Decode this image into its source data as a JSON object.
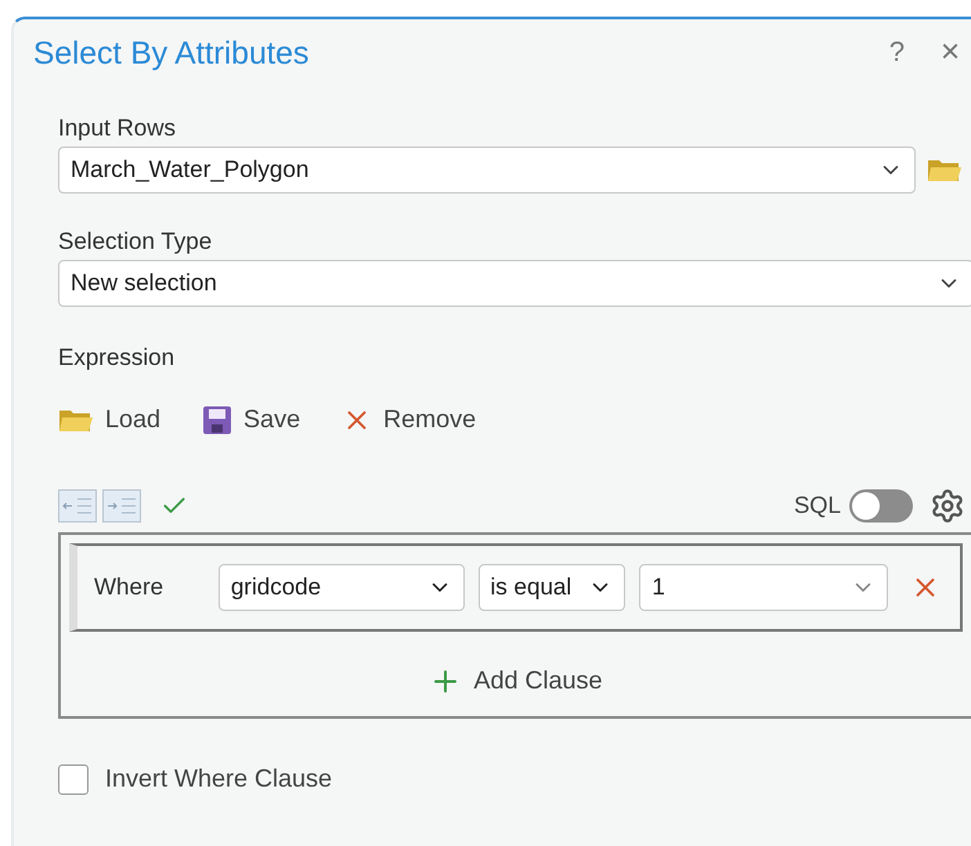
{
  "window": {
    "title": "Select By Attributes",
    "help": "?",
    "close": "×"
  },
  "input_rows": {
    "label": "Input Rows",
    "value": "March_Water_Polygon"
  },
  "selection_type": {
    "label": "Selection Type",
    "value": "New selection"
  },
  "expression": {
    "label": "Expression",
    "actions": [
      {
        "kind": "load",
        "label": "Load"
      },
      {
        "kind": "save",
        "label": "Save"
      },
      {
        "kind": "remove",
        "label": "Remove"
      }
    ],
    "sql": {
      "label": "SQL",
      "on": false
    },
    "clauses": [
      {
        "keyword": "Where",
        "field": "gridcode",
        "operator": "is equal",
        "value": "1"
      }
    ],
    "add_clause": "Add Clause"
  },
  "invert": {
    "label": "Invert Where Clause",
    "checked": false
  }
}
